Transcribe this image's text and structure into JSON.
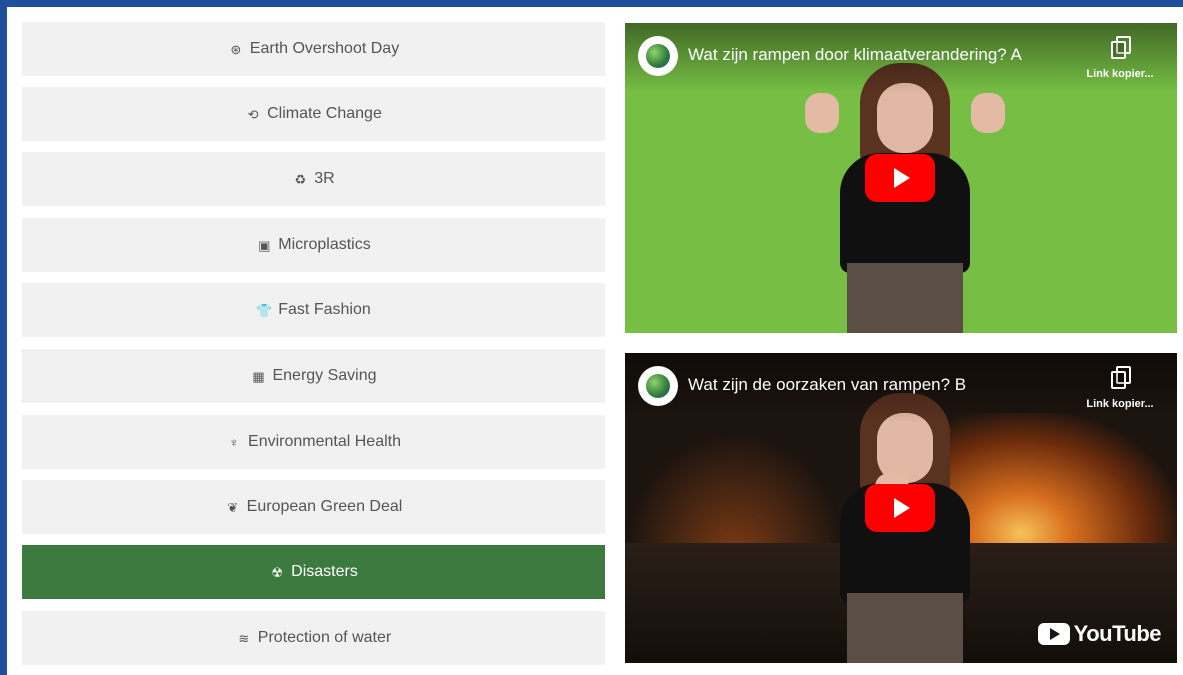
{
  "menu": {
    "items": [
      {
        "label": "Earth Overshoot Day",
        "icon": "earth-icon",
        "glyph": "⊛",
        "active": false
      },
      {
        "label": "Climate Change",
        "icon": "climate-icon",
        "glyph": "⟲",
        "active": false
      },
      {
        "label": "3R",
        "icon": "recycle-icon",
        "glyph": "♻",
        "active": false
      },
      {
        "label": "Microplastics",
        "icon": "bottle-icon",
        "glyph": "▣",
        "active": false
      },
      {
        "label": "Fast Fashion",
        "icon": "shirt-icon",
        "glyph": "👕",
        "active": false
      },
      {
        "label": "Energy Saving",
        "icon": "solar-panel-icon",
        "glyph": "▦",
        "active": false
      },
      {
        "label": "Environmental Health",
        "icon": "hand-plant-icon",
        "glyph": "♆",
        "active": false
      },
      {
        "label": "European Green Deal",
        "icon": "leaf-icon",
        "glyph": "❦",
        "active": false
      },
      {
        "label": "Disasters",
        "icon": "radiation-icon",
        "glyph": "☢",
        "active": true
      },
      {
        "label": "Protection of water",
        "icon": "water-waves-icon",
        "glyph": "≋",
        "active": false
      }
    ]
  },
  "videos": [
    {
      "title": "Wat zijn rampen door klimaatverandering? A",
      "copy_label": "Link kopier..."
    },
    {
      "title": "Wat zijn de oorzaken van rampen? B",
      "copy_label": "Link kopier...",
      "brand": "YouTube"
    }
  ],
  "colors": {
    "active": "#3d7a3f",
    "inactive": "#f1f1f1",
    "frame": "#1f4f9a",
    "green_screen": "#76bf44",
    "play": "#ff0000"
  }
}
